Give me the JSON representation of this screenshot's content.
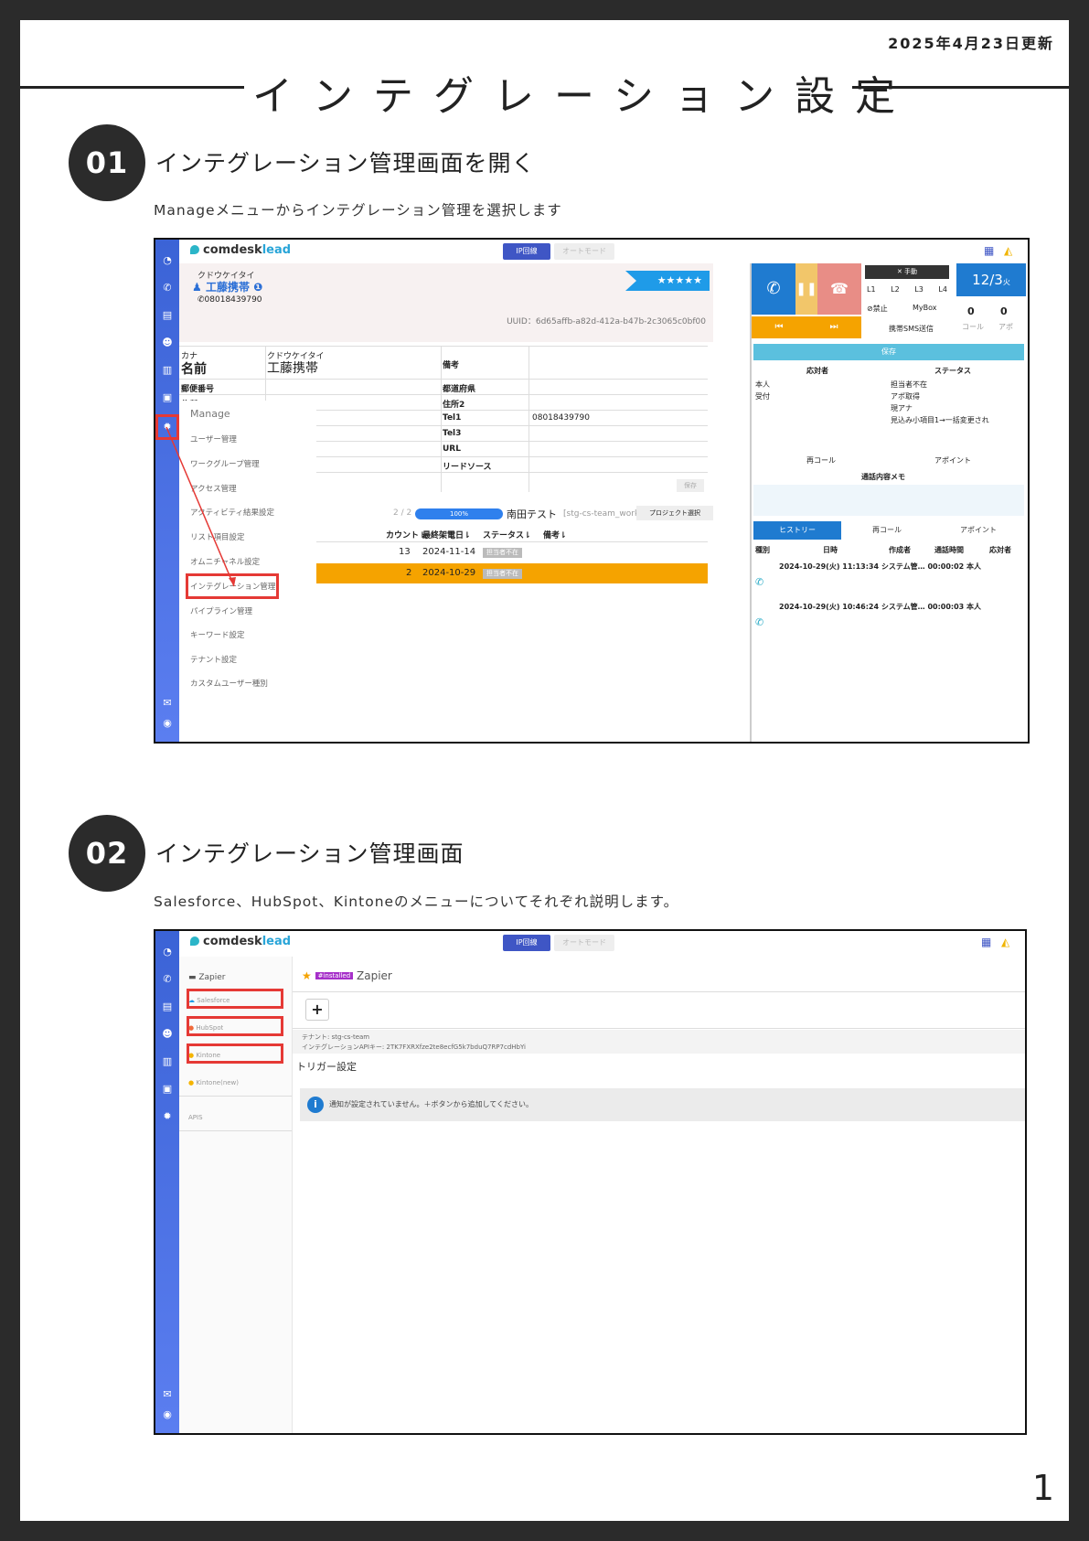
{
  "header": {
    "updated": "2025年4月23日更新",
    "title": "インテグレーション設定",
    "page_number": "1"
  },
  "steps": [
    {
      "number": "01",
      "title": "インテグレーション管理画面を開く",
      "desc": "Manageメニューからインテグレーション管理を選択します"
    },
    {
      "number": "02",
      "title": "インテグレーション管理画面",
      "desc": "Salesforce、HubSpot、Kintoneのメニューについてそれぞれ説明します。"
    }
  ],
  "app": {
    "logo_a": "comdesk",
    "logo_b": "lead",
    "ip_line": "IP回線",
    "auto_mode": "オートモード"
  },
  "shot1": {
    "contact_kana": "クドウケイタイ",
    "contact_name": "工藤携帯",
    "contact_phone": "08018439790",
    "stars": "★★★★★",
    "uuid": "UUID：6d65affb-a82d-412a-b47b-2c3065c0bf00",
    "form": {
      "kana_label": "カナ",
      "name_label": "名前",
      "name_kana": "クドウケイタイ",
      "name_value": "工藤携帯",
      "remarks": "備考",
      "zip": "郵便番号",
      "addr1": "住所1",
      "pref": "都道府県",
      "addr2": "住所2",
      "tel1": "Tel1",
      "tel1_value": "08018439790",
      "tel3": "Tel3",
      "url": "URL",
      "lead_source": "リードソース",
      "save": "保存"
    },
    "manage_menu": {
      "title": "Manage",
      "items": [
        "ユーザー管理",
        "ワークグループ管理",
        "アクセス管理",
        "アクティビティ結果設定",
        "リスト項目設定",
        "オムニチャネル設定",
        "インテグレーション管理",
        "パイプライン管理",
        "キーワード設定",
        "テナント設定",
        "カスタムユーザー種別"
      ]
    },
    "list": {
      "progress_count": "2 / 2",
      "progress_pct": "100%",
      "project": "南田テスト",
      "workgroup": "[stg-cs-team_workgroup]",
      "project_select": "プロジェクト選択",
      "columns": [
        "カウント⇂",
        "最終架電日⇂",
        "ステータス⇂",
        "備考⇂"
      ],
      "rows": [
        {
          "count": "13",
          "date": "2024-11-14",
          "status": "担当者不在"
        },
        {
          "count": "2",
          "date": "2024-10-29",
          "status": "担当者不在"
        }
      ]
    },
    "phone": {
      "manual": "✕ 手動",
      "lines": [
        "L1",
        "L2",
        "L3",
        "L4"
      ],
      "ban": "⊘禁止",
      "mybox": "MyBox",
      "sms": "携帯SMS送信",
      "date": "12/3",
      "weekday": "火",
      "call_count": "0",
      "call_label": "コール",
      "apo_count": "0",
      "apo_label": "アポ"
    },
    "status_panel": {
      "save": "保存",
      "responder_header": "応対者",
      "status_header": "ステータス",
      "responders": [
        "本人",
        "受付"
      ],
      "statuses": [
        "担当者不在",
        "アポ取得",
        "現アナ",
        "見込み小項目1→一括変更され"
      ],
      "recall": "再コール",
      "appoint": "アポイント",
      "memo_title": "通話内容メモ"
    },
    "history": {
      "tabs": [
        "ヒストリー",
        "再コール",
        "アポイント"
      ],
      "columns": [
        "種別",
        "日時",
        "作成者",
        "通話時間",
        "応対者"
      ],
      "rows": [
        {
          "datetime": "2024-10-29(火) 11:13:34",
          "creator": "システム管…",
          "duration": "00:00:02",
          "responder": "本人"
        },
        {
          "datetime": "2024-10-29(火) 10:46:24",
          "creator": "システム管…",
          "duration": "00:00:03",
          "responder": "本人"
        }
      ]
    }
  },
  "shot2": {
    "side_items": [
      "Zapier",
      "Salesforce",
      "HubSpot",
      "Kintone",
      "Kintone(new)",
      "APIS"
    ],
    "installed_badge": "#installed",
    "app_title": "Zapier",
    "add_button": "+",
    "tenant": "テナント: stg-cs-team",
    "api_key": "インテグレーションAPIキー: 2TK7FXRXfze2te8ecfG5k7bduQ7RP7cdHbYi",
    "trigger_title": "トリガー設定",
    "notice": "通知が設定されていません。＋ボタンから追加してください。"
  }
}
